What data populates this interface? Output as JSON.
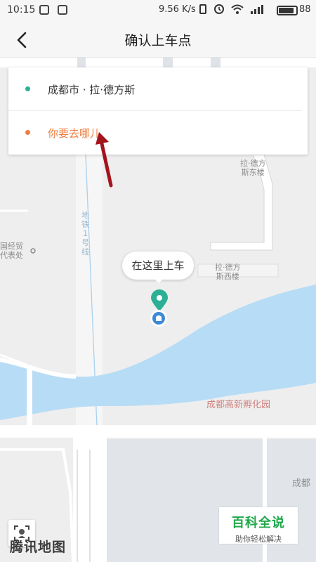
{
  "status_bar": {
    "time": "10:15",
    "speed": "9.56 K/s",
    "battery": "88",
    "battery_level": 0.88
  },
  "header": {
    "title": "确认上车点"
  },
  "route_card": {
    "origin": "成都市 · 拉·德方斯",
    "destination_placeholder": "你要去哪儿"
  },
  "map": {
    "labels": {
      "east_building_1": "拉·德方",
      "east_building_2": "斯东楼",
      "west_building_1": "拉·德方",
      "west_building_2": "斯西楼",
      "metro_1": "地",
      "metro_2": "铁",
      "metro_3": "1",
      "metro_4": "号",
      "metro_5": "线",
      "office_1": "国经贸",
      "office_2": "代表处",
      "incubator": "成都高新孵化园",
      "chengdu_edge": "成都"
    },
    "pickup_bubble": "在这里上车",
    "provider": "腾讯地图",
    "colors": {
      "land": "#eeeeee",
      "water": "#b7dcf5",
      "road": "#ffffff",
      "block": "#e1e5ea",
      "origin_dot": "#2bb096",
      "destination": "#ef7f3f",
      "pin": "#2bb096"
    }
  },
  "watermark": {
    "line1": "百科全说",
    "line2": "助你轻松解决"
  }
}
